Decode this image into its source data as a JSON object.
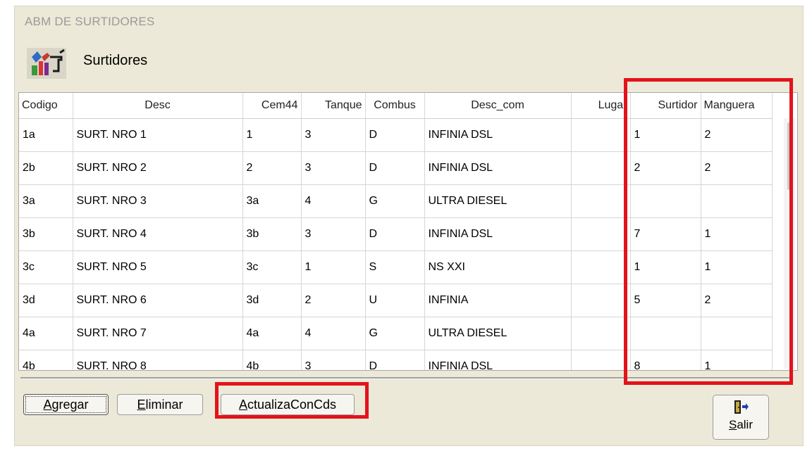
{
  "window": {
    "title": "ABM DE SURTIDORES"
  },
  "form": {
    "caption": "Surtidores",
    "icon": "fuel-pump-tools-icon"
  },
  "grid": {
    "columns": [
      "Codigo",
      "Desc",
      "Cem44",
      "Tanque",
      "Combus",
      "Desc_com",
      "Lugar",
      "Surtidor",
      "Manguera"
    ],
    "rows": [
      [
        "1a",
        "SURT. NRO 1",
        "1",
        "3",
        "D",
        "INFINIA  DSL",
        "",
        "1",
        "2"
      ],
      [
        "2b",
        "SURT. NRO 2",
        "2",
        "3",
        "D",
        "INFINIA  DSL",
        "",
        "2",
        "2"
      ],
      [
        "3a",
        "SURT. NRO 3",
        "3a",
        "4",
        "G",
        "ULTRA DIESEL",
        "",
        "",
        ""
      ],
      [
        "3b",
        "SURT. NRO 4",
        "3b",
        "3",
        "D",
        "INFINIA  DSL",
        "",
        "7",
        "1"
      ],
      [
        "3c",
        "SURT. NRO 5",
        "3c",
        "1",
        "S",
        "NS XXI",
        "",
        "1",
        "1"
      ],
      [
        "3d",
        "SURT. NRO 6",
        "3d",
        "2",
        "U",
        "INFINIA",
        "",
        "5",
        "2"
      ],
      [
        "4a",
        "SURT. NRO 7",
        "4a",
        "4",
        "G",
        "ULTRA DIESEL",
        "",
        "",
        ""
      ],
      [
        "4b",
        "SURT. NRO 8",
        "4b",
        "3",
        "D",
        "INFINIA  DSL",
        "",
        "8",
        "1"
      ]
    ]
  },
  "buttons": {
    "agregar": {
      "accel": "A",
      "rest": "gregar"
    },
    "eliminar": {
      "accel": "E",
      "rest": "liminar"
    },
    "actualiza": {
      "accel": "A",
      "rest": "ctualizaConCds"
    },
    "salir": {
      "accel": "S",
      "rest": "alir",
      "icon": "exit-door-icon"
    }
  },
  "colors": {
    "highlight": "#e3131b",
    "window_bg": "#ece9d8"
  }
}
